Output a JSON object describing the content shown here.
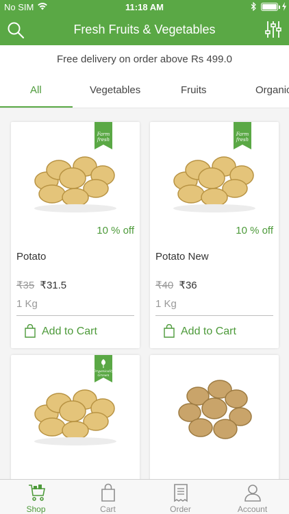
{
  "status": {
    "carrier": "No SIM",
    "time": "11:18 AM"
  },
  "header": {
    "title": "Fresh Fruits & Vegetables",
    "search_icon": "search-icon",
    "filter_icon": "filter-sliders-icon"
  },
  "banner": {
    "text": "Free delivery on order above Rs 499.0"
  },
  "tabs": [
    {
      "label": "All",
      "active": true
    },
    {
      "label": "Vegetables",
      "active": false
    },
    {
      "label": "Fruits",
      "active": false
    },
    {
      "label": "Organic",
      "active": false
    }
  ],
  "products": [
    {
      "name": "Potato",
      "discount": "10 % off",
      "old_price": "₹35",
      "price": "₹31.5",
      "unit": "1 Kg",
      "add_label": "Add to Cart",
      "badge": "farm-fresh-badge"
    },
    {
      "name": "Potato New",
      "discount": "10 % off",
      "old_price": "₹40",
      "price": "₹36",
      "unit": "1 Kg",
      "add_label": "Add to Cart",
      "badge": "farm-fresh-badge"
    },
    {
      "badge": "organically-grown-badge"
    },
    {
      "badge": ""
    }
  ],
  "tabbar": [
    {
      "label": "Shop",
      "icon": "shop-cart-icon",
      "active": true
    },
    {
      "label": "Cart",
      "icon": "shopping-bag-icon",
      "active": false
    },
    {
      "label": "Order",
      "icon": "receipt-icon",
      "active": false
    },
    {
      "label": "Account",
      "icon": "person-icon",
      "active": false
    }
  ],
  "colors": {
    "brand_green": "#5aa845",
    "text_green": "#4d9a3a",
    "background": "#f4f4f4"
  }
}
